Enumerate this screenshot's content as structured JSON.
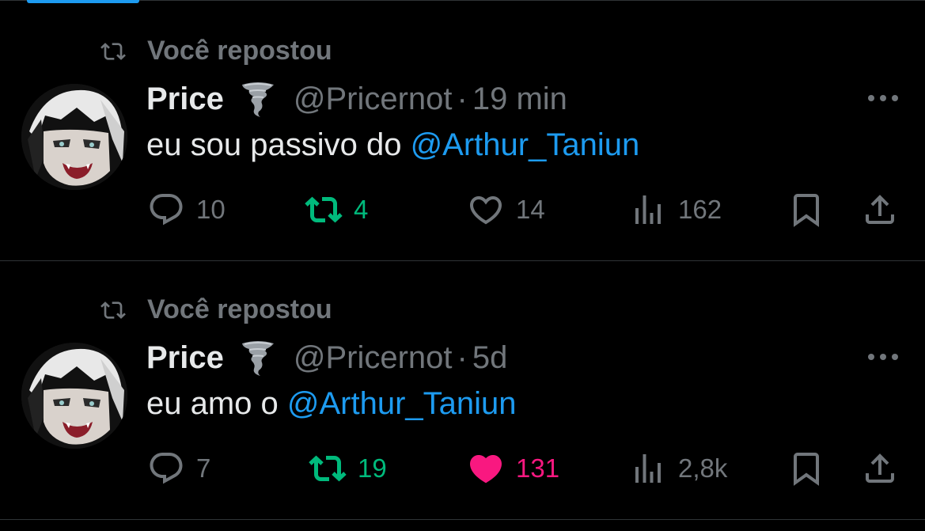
{
  "tweets": [
    {
      "repost_label": "Você repostou",
      "name": "Price",
      "emoji": "tornado",
      "handle": "@Pricernot",
      "separator": "·",
      "time": "19 min",
      "text_prefix": "eu sou passivo do ",
      "mention": "@Arthur_Taniun",
      "replies": "10",
      "reposts": "4",
      "reposted": true,
      "likes": "14",
      "liked": false,
      "views": "162"
    },
    {
      "repost_label": "Você repostou",
      "name": "Price",
      "emoji": "tornado",
      "handle": "@Pricernot",
      "separator": "·",
      "time": "5d",
      "text_prefix": "eu amo o ",
      "mention": "@Arthur_Taniun",
      "replies": "7",
      "reposts": "19",
      "reposted": true,
      "likes": "131",
      "liked": true,
      "views": "2,8k"
    }
  ],
  "colors": {
    "background": "#000000",
    "text": "#e7e9ea",
    "muted": "#71767b",
    "link": "#1d9bf0",
    "repost_active": "#00ba7c",
    "like_active": "#f91880",
    "divider": "#2f3336"
  }
}
